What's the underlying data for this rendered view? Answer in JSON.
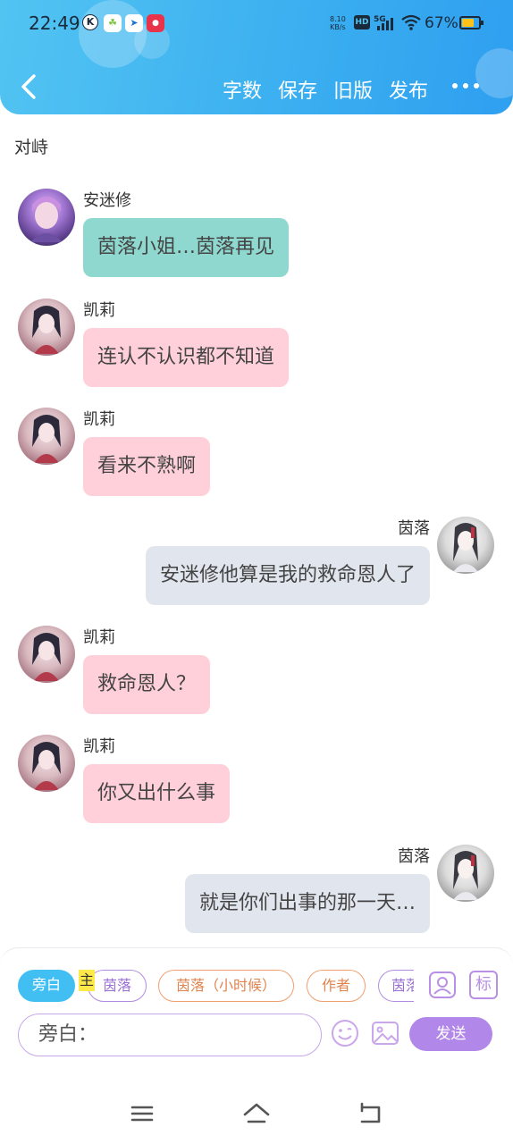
{
  "status_bar": {
    "time": "22:49",
    "net_speed_value": "8.10",
    "net_speed_unit": "KB/s",
    "hd_badge": "HD",
    "network": "5G",
    "battery_percent": "67%",
    "mini_icons": [
      {
        "name": "k-app-icon",
        "glyph": "K",
        "color": "#1a2a3a"
      },
      {
        "name": "sprout-app-icon",
        "glyph": "☘",
        "color": "#7cc242"
      },
      {
        "name": "arrow-app-icon",
        "glyph": "➤",
        "color": "#1e73d2"
      },
      {
        "name": "red-app-icon",
        "glyph": "●",
        "color": "#e8334a"
      }
    ]
  },
  "header": {
    "back_icon": "chevron-left-icon",
    "actions": [
      "字数",
      "保存",
      "旧版",
      "发布"
    ],
    "more_label": "•••"
  },
  "scene_label": "对峙",
  "messages": [
    {
      "side": "left",
      "name": "安迷修",
      "text": "茵落小姐…茵落再见",
      "style": "teal",
      "avatar": "avatar-anmixiu"
    },
    {
      "side": "left",
      "name": "凯莉",
      "text": "连认不认识都不知道",
      "style": "pink",
      "avatar": "avatar-kaili"
    },
    {
      "side": "left",
      "name": "凯莉",
      "text": "看来不熟啊",
      "style": "pink",
      "avatar": "avatar-kaili"
    },
    {
      "side": "right",
      "name": "茵落",
      "text": "安迷修他算是我的救命恩人了",
      "style": "gray",
      "avatar": "avatar-yinluo"
    },
    {
      "side": "left",
      "name": "凯莉",
      "text": "救命恩人？",
      "style": "pink",
      "avatar": "avatar-kaili"
    },
    {
      "side": "left",
      "name": "凯莉",
      "text": "你又出什么事",
      "style": "pink",
      "avatar": "avatar-kaili"
    },
    {
      "side": "right",
      "name": "茵落",
      "text": "就是你们出事的那一天…",
      "style": "gray",
      "avatar": "avatar-yinluo"
    }
  ],
  "composer": {
    "role_chips": [
      "旁白",
      "茵落",
      "茵落（小时候）",
      "作者",
      "茵落"
    ],
    "main_marker": "主",
    "tool_icons": [
      "character-icon",
      "tag-icon"
    ],
    "tag_icon_glyph": "标",
    "input_value": "旁白：",
    "emoji_icon": "emoji-icon",
    "image_icon": "image-icon",
    "send_label": "发送"
  },
  "nav": {
    "icons": [
      "menu-icon",
      "home-icon",
      "back-nav-icon"
    ]
  },
  "colors": {
    "header_gradient_start": "#52c4f2",
    "header_gradient_end": "#2f9ff0",
    "bubble_teal": "#8fd8cf",
    "bubble_pink": "#ffd0d9",
    "bubble_gray": "#e1e6ee",
    "accent_purple": "#b287ea",
    "chip_active": "#42bff2"
  }
}
